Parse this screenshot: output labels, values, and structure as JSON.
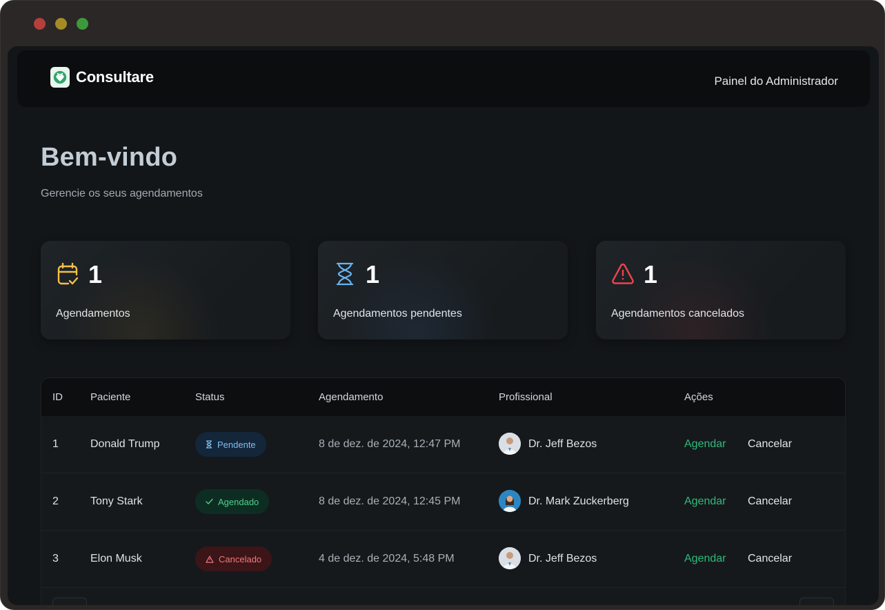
{
  "header": {
    "brand": "Consultare",
    "admin_label": "Painel do Administrador"
  },
  "hero": {
    "title": "Bem-vindo",
    "subtitle": "Gerencie os seus agendamentos"
  },
  "stats": [
    {
      "icon": "calendar-check-icon",
      "count": "1",
      "label": "Agendamentos",
      "color": "#f5c04a"
    },
    {
      "icon": "hourglass-icon",
      "count": "1",
      "label": "Agendamentos pendentes",
      "color": "#6ab4f0"
    },
    {
      "icon": "alert-triangle-icon",
      "count": "1",
      "label": "Agendamentos cancelados",
      "color": "#f0434c"
    }
  ],
  "table": {
    "columns": [
      "ID",
      "Paciente",
      "Status",
      "Agendamento",
      "Profissional",
      "Ações"
    ],
    "rows": [
      {
        "id": "1",
        "patient": "Donald Trump",
        "status": "Pendente",
        "status_type": "pending",
        "date": "8 de dez. de 2024, 12:47 PM",
        "professional": "Dr. Jeff Bezos",
        "schedule_label": "Agendar",
        "cancel_label": "Cancelar"
      },
      {
        "id": "2",
        "patient": "Tony Stark",
        "status": "Agendado",
        "status_type": "scheduled",
        "date": "8 de dez. de 2024, 12:45 PM",
        "professional": "Dr. Mark Zuckerberg",
        "schedule_label": "Agendar",
        "cancel_label": "Cancelar"
      },
      {
        "id": "3",
        "patient": "Elon Musk",
        "status": "Cancelado",
        "status_type": "cancelled",
        "date": "4 de dez. de 2024, 5:48 PM",
        "professional": "Dr. Jeff Bezos",
        "schedule_label": "Agendar",
        "cancel_label": "Cancelar"
      }
    ]
  },
  "colors": {
    "accent_green": "#2fbb7a",
    "background": "#131619",
    "pending": "#83bff0",
    "scheduled": "#4fd08f",
    "cancelled": "#f2797c"
  }
}
